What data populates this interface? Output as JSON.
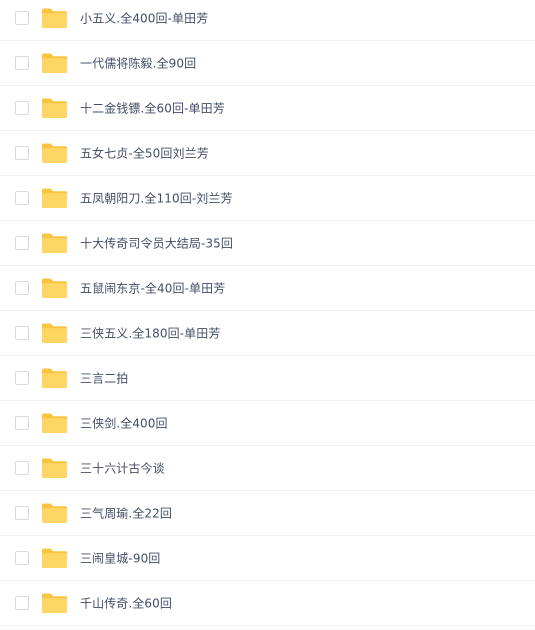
{
  "folder_icon_colors": {
    "back": "#f9c440",
    "front": "#ffd664"
  },
  "files": [
    {
      "name": "小五义.全400回-单田芳",
      "icon": "folder-icon"
    },
    {
      "name": "一代儒将陈毅.全90回",
      "icon": "folder-icon"
    },
    {
      "name": "十二金钱镖.全60回-单田芳",
      "icon": "folder-icon"
    },
    {
      "name": "五女七贞-全50回刘兰芳",
      "icon": "folder-icon"
    },
    {
      "name": "五凤朝阳刀.全110回-刘兰芳",
      "icon": "folder-icon"
    },
    {
      "name": "十大传奇司令员大结局-35回",
      "icon": "folder-icon"
    },
    {
      "name": "五鼠闹东京-全40回-单田芳",
      "icon": "folder-icon"
    },
    {
      "name": "三侠五义.全180回-单田芳",
      "icon": "folder-icon"
    },
    {
      "name": "三言二拍",
      "icon": "folder-icon"
    },
    {
      "name": "三侠剑.全400回",
      "icon": "folder-icon"
    },
    {
      "name": "三十六计古今谈",
      "icon": "folder-icon"
    },
    {
      "name": "三气周瑜.全22回",
      "icon": "folder-icon"
    },
    {
      "name": "三闹皇城-90回",
      "icon": "folder-icon"
    },
    {
      "name": "千山传奇.全60回",
      "icon": "folder-icon"
    }
  ]
}
